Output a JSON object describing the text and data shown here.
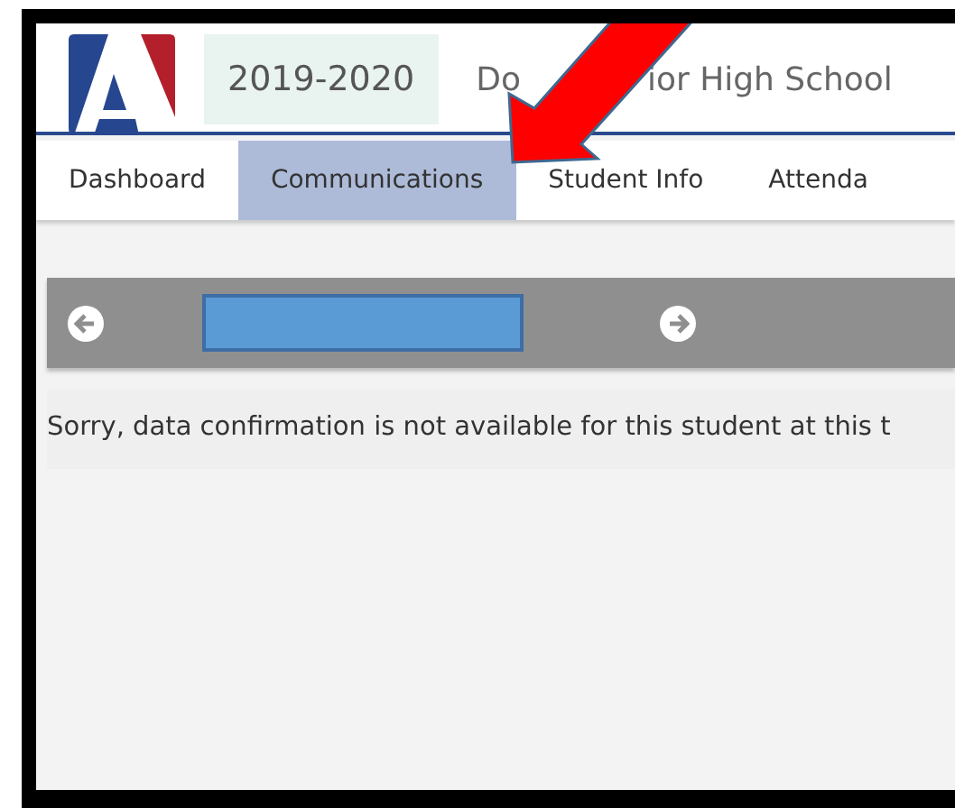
{
  "header": {
    "school_year": "2019-2020",
    "school_name_parts": [
      "Do",
      "ior High School"
    ]
  },
  "tabs": [
    {
      "label": "Dashboard",
      "selected": false
    },
    {
      "label": "Communications",
      "selected": true
    },
    {
      "label": "Student Info",
      "selected": false
    },
    {
      "label": "Attenda",
      "selected": false
    }
  ],
  "message": "Sorry, data confirmation is not available for this student at this t"
}
